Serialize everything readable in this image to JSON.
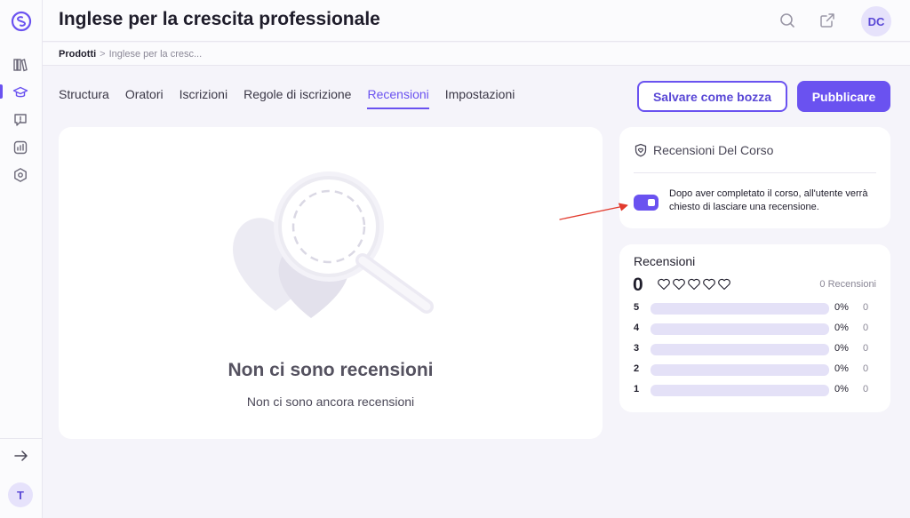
{
  "header": {
    "title": "Inglese per la crescita professionale",
    "avatar_initials": "DC"
  },
  "breadcrumb": {
    "root": "Prodotti",
    "separator": ">",
    "current": "Inglese per la cresc..."
  },
  "tabs": [
    {
      "label": "Structura",
      "active": false
    },
    {
      "label": "Oratori",
      "active": false
    },
    {
      "label": "Iscrizioni",
      "active": false
    },
    {
      "label": "Regole di iscrizione",
      "active": false
    },
    {
      "label": "Recensioni",
      "active": true
    },
    {
      "label": "Impostazioni",
      "active": false
    }
  ],
  "actions": {
    "save_draft": "Salvare come bozza",
    "publish": "Pubblicare"
  },
  "empty_state": {
    "title": "Non ci sono recensioni",
    "subtitle": "Non ci sono ancora recensioni"
  },
  "course_reviews": {
    "title": "Recensioni Del Corso",
    "toggle_enabled": true,
    "toggle_description": "Dopo aver completato il corso, all'utente verrà chiesto di lasciare una recensione."
  },
  "ratings": {
    "title": "Recensioni",
    "score": "0",
    "hearts_filled": 0,
    "hearts_total": 5,
    "total_label": "0 Recensioni",
    "rows": [
      {
        "stars": "5",
        "percent": "0%",
        "count": "0",
        "fill": 0
      },
      {
        "stars": "4",
        "percent": "0%",
        "count": "0",
        "fill": 0
      },
      {
        "stars": "3",
        "percent": "0%",
        "count": "0",
        "fill": 0
      },
      {
        "stars": "2",
        "percent": "0%",
        "count": "0",
        "fill": 0
      },
      {
        "stars": "1",
        "percent": "0%",
        "count": "0",
        "fill": 0
      }
    ]
  },
  "sidebar": {
    "user_initial": "T",
    "items": [
      {
        "icon": "library-icon",
        "active": false
      },
      {
        "icon": "graduation-cap-icon",
        "active": true
      },
      {
        "icon": "feedback-icon",
        "active": false
      },
      {
        "icon": "analytics-icon",
        "active": false
      },
      {
        "icon": "settings-icon",
        "active": false
      }
    ]
  },
  "colors": {
    "accent": "#6a52f0",
    "annotation_arrow": "#e23b2e"
  }
}
